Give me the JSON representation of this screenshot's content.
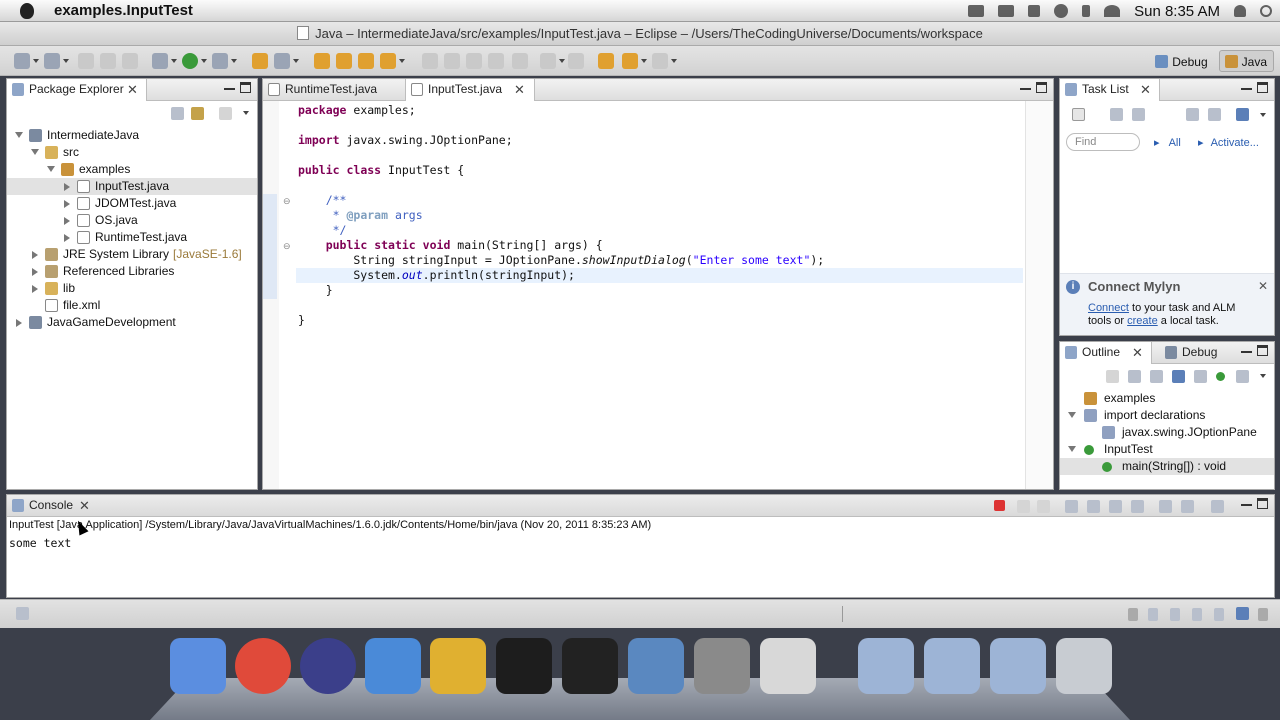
{
  "menubar": {
    "app_name": "examples.InputTest",
    "clock": "Sun 8:35 AM"
  },
  "window": {
    "title": "Java – IntermediateJava/src/examples/InputTest.java – Eclipse – /Users/TheCodingUniverse/Documents/workspace"
  },
  "perspectives": [
    {
      "label": "Debug"
    },
    {
      "label": "Java",
      "active": true
    }
  ],
  "package_explorer": {
    "tab_label": "Package Explorer",
    "tree": [
      {
        "label": "IntermediateJava",
        "depth": 0,
        "expanded": true,
        "icon": "project-icon"
      },
      {
        "label": "src",
        "depth": 1,
        "expanded": true,
        "icon": "source-folder-icon"
      },
      {
        "label": "examples",
        "depth": 2,
        "expanded": true,
        "icon": "package-icon"
      },
      {
        "label": "InputTest.java",
        "depth": 3,
        "expanded": false,
        "icon": "java-file-icon",
        "selected": true
      },
      {
        "label": "JDOMTest.java",
        "depth": 3,
        "expanded": false,
        "icon": "java-file-icon"
      },
      {
        "label": "OS.java",
        "depth": 3,
        "expanded": false,
        "icon": "java-file-icon"
      },
      {
        "label": "RuntimeTest.java",
        "depth": 3,
        "expanded": false,
        "icon": "java-file-icon"
      },
      {
        "label": "JRE System Library",
        "decoration": "[JavaSE-1.6]",
        "depth": 1,
        "expanded": false,
        "icon": "library-icon"
      },
      {
        "label": "Referenced Libraries",
        "depth": 1,
        "expanded": false,
        "icon": "library-icon"
      },
      {
        "label": "lib",
        "depth": 1,
        "expanded": false,
        "icon": "folder-icon"
      },
      {
        "label": "file.xml",
        "depth": 1,
        "leaf": true,
        "icon": "xml-file-icon"
      },
      {
        "label": "JavaGameDevelopment",
        "depth": 0,
        "expanded": false,
        "icon": "project-icon"
      }
    ]
  },
  "editor": {
    "tabs": [
      {
        "label": "RuntimeTest.java"
      },
      {
        "label": "InputTest.java",
        "active": true
      }
    ],
    "lines": [
      [
        {
          "t": "package",
          "c": "kw"
        },
        {
          "t": " examples;"
        }
      ],
      [],
      [
        {
          "t": "import",
          "c": "kw"
        },
        {
          "t": " javax.swing.JOptionPane;"
        }
      ],
      [],
      [
        {
          "t": "public",
          "c": "kw"
        },
        {
          "t": " "
        },
        {
          "t": "class",
          "c": "kw"
        },
        {
          "t": " InputTest {"
        }
      ],
      [],
      [
        {
          "t": "    /**",
          "c": "cm"
        }
      ],
      [
        {
          "t": "     * ",
          "c": "cm"
        },
        {
          "t": "@param",
          "c": "tag"
        },
        {
          "t": " args",
          "c": "cm"
        }
      ],
      [
        {
          "t": "     */",
          "c": "cm"
        }
      ],
      [
        {
          "t": "    "
        },
        {
          "t": "public",
          "c": "kw"
        },
        {
          "t": " "
        },
        {
          "t": "static",
          "c": "kw"
        },
        {
          "t": " "
        },
        {
          "t": "void",
          "c": "kw"
        },
        {
          "t": " main(String[] args) {"
        }
      ],
      [
        {
          "t": "        String stringInput = JOptionPane."
        },
        {
          "t": "showInputDialog",
          "c": "ital"
        },
        {
          "t": "("
        },
        {
          "t": "\"Enter some text\"",
          "c": "str"
        },
        {
          "t": ");"
        }
      ],
      [
        {
          "t": "        System."
        },
        {
          "t": "out",
          "c": "fld"
        },
        {
          "t": ".println(stringInput);"
        }
      ],
      [
        {
          "t": "    }"
        }
      ],
      [],
      [
        {
          "t": "}"
        }
      ]
    ],
    "current_line": 11
  },
  "task_list": {
    "tab_label": "Task List",
    "find_placeholder": "Find",
    "filter_all": "All",
    "activate": "Activate...",
    "mylyn": {
      "title": "Connect Mylyn",
      "connect": "Connect",
      "text1": " to your task and ALM",
      "text2a": "tools or ",
      "create": "create",
      "text2b": " a local task."
    }
  },
  "outline": {
    "tab_outline": "Outline",
    "tab_debug": "Debug",
    "tree": [
      {
        "label": "examples",
        "depth": 0,
        "icon": "package-icon"
      },
      {
        "label": "import declarations",
        "depth": 0,
        "expanded": true,
        "icon": "imports-icon"
      },
      {
        "label": "javax.swing.JOptionPane",
        "depth": 1,
        "icon": "import-icon"
      },
      {
        "label": "InputTest",
        "depth": 0,
        "expanded": true,
        "icon": "class-icon"
      },
      {
        "label": "main(String[]) : void",
        "depth": 1,
        "icon": "method-icon",
        "selected": true
      }
    ]
  },
  "console": {
    "tab_label": "Console",
    "header": "InputTest [Java Application] /System/Library/Java/JavaVirtualMachines/1.6.0.jdk/Contents/Home/bin/java (Nov 20, 2011 8:35:23 AM)",
    "output": "some text"
  },
  "dock": {
    "apps": [
      "finder-icon",
      "chrome-icon",
      "eclipse-icon",
      "xcode-icon",
      "dashcode-icon",
      "activity-monitor-icon",
      "terminal-icon",
      "preview-icon",
      "system-preferences-icon",
      "java-icon"
    ],
    "folders": [
      "applications-folder-icon",
      "documents-folder-icon",
      "downloads-folder-icon",
      "trash-icon"
    ]
  }
}
